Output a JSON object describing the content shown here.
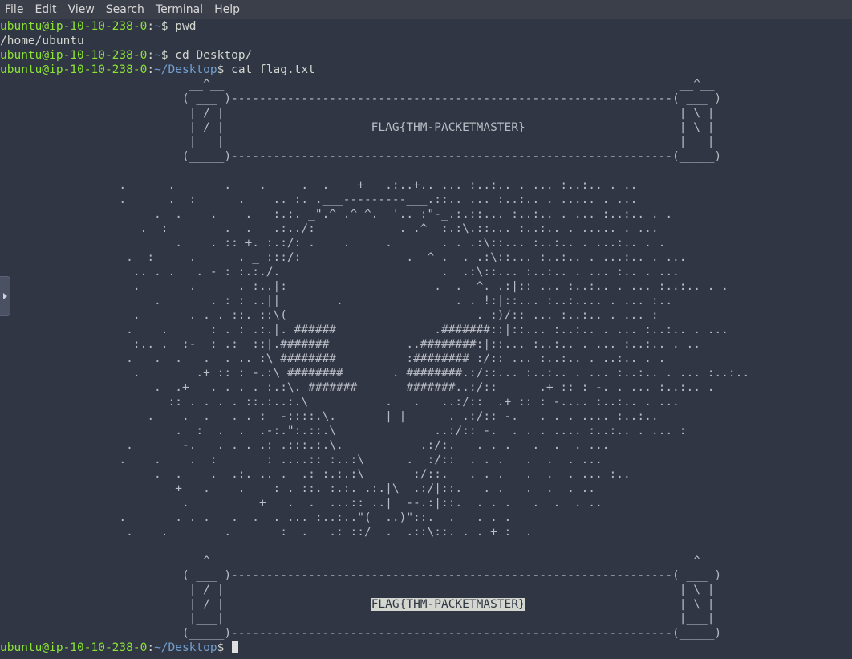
{
  "menu": {
    "items": [
      "File",
      "Edit",
      "View",
      "Search",
      "Terminal",
      "Help"
    ]
  },
  "terminal": {
    "lines": [
      {
        "user": "ubuntu@ip-10-10-238-0",
        "sep": ":",
        "path": "~",
        "sigil": "$",
        "cmd": " pwd"
      },
      {
        "text": "/home/ubuntu"
      },
      {
        "user": "ubuntu@ip-10-10-238-0",
        "sep": ":",
        "path": "~",
        "sigil": "$",
        "cmd": " cd Desktop/"
      },
      {
        "user": "ubuntu@ip-10-10-238-0",
        "sep": ":",
        "path": "~/Desktop",
        "sigil": "$",
        "cmd": " cat flag.txt"
      },
      {
        "art": "                           __^__                                                                 __^__"
      },
      {
        "art": "                          ( ___ )---------------------------------------------------------------( ___ )"
      },
      {
        "art": "                           | / |                                                                 | \\ |"
      },
      {
        "art": "                           | / |                     FLAG{THM-PACKETMASTER}                      | \\ |"
      },
      {
        "art": "                           |___|                                                                 |___|"
      },
      {
        "art": "                          (_____)---------------------------------------------------------------(_____)"
      },
      {
        "art": ""
      },
      {
        "art": "                 .      .       .    .     .  .    +   .:..+.. ... :..:.. . ... :..:.. . .."
      },
      {
        "art": "                 .      .  :      .    .. :. .___---------___.::.. ... :..:.. . ..... . ..."
      },
      {
        "art": "                      .  .    .    .   :.:. _\".^ .^ ^.  '.. :\"-_.:.::... :..:.. . ... :..:.. . ."
      },
      {
        "art": "                    .  :        .  .   .:../:            . .^  :.:\\.::... :..:.. . ..... . ..."
      },
      {
        "art": "                         .    . :: +. :.:/: .    .     .       . . .:\\::... :..:.. . ...:.. . ."
      },
      {
        "art": "                  .  :     .      . _ :::/:               .  ^ .  . .:\\::... :..:.. . ...:.. . ..."
      },
      {
        "art": "                   .. . .   . - : :.:./.                       .  .:\\::... :..:.. . ... :.. . ..."
      },
      {
        "art": "                   .       .      . :..|:                     .  .  ^. .:|:: ... :..:.. . ... :..:.. . ."
      },
      {
        "art": "                      .       . : : ..||        .                . . !:|::... :..:.... . ... :.."
      },
      {
        "art": "                   .       . . . ::. ::\\(                           . :)/:: ... :..:.. . ... :"
      },
      {
        "art": "                  .    .      : . : .:.|. ######              .#######::|::... :..:.. . ... :..:.. . ..."
      },
      {
        "art": "                   :.. .  :-  : .:  ::|.#######           ..########:|::... :..:.. . ... :..:.. . .."
      },
      {
        "art": "                  .   .  .   .  . .. :\\ ########          :######## :/:: ... :..:.. . ..:.. . ."
      },
      {
        "art": "                   .        .+ :: : -.:\\ ########       . ########.:/::... :..:.. . ... :..:.. . ... :..:.."
      },
      {
        "art": "                      .  .+   . . . . :.:\\. #######       #######..:/::      .+ :: : -. . ... :..:.. ."
      },
      {
        "art": "                        :: . . . . ::.:..:.\\           .   .   ..:/::  .+ :: : -.... :..:.. . ..."
      },
      {
        "art": "                     .    .  .   . . :  -::::.\\.       | |      . .:/:: -.   . . . .... :..:.."
      },
      {
        "art": "                         .  :  .  .  .-:.\":.::.\\              ..:/:: -.  . . . .... :..:.. . ... :"
      },
      {
        "art": "                  .       -.   . . . .: .:::.:.\\.           .:/:.   . . .   .  .  . ..."
      },
      {
        "art": "                 .    .    .  :       : ....::_:..:\\   ___.  :/::  . . .   .  .  . ..."
      },
      {
        "art": "                      .  .    .  .:. .. .  .: :.:.:\\       :/::.   . . .   .  .  . ... :.."
      },
      {
        "art": "                         +   .    .    : . ::. :.:. .:.|\\  .:/|::.   . .   .  .  . .."
      },
      {
        "art": "                          .          +   .  .  ...:: ..|  --.:|::.  . . .   .  .  . .."
      },
      {
        "art": "                 .       . . .   .  .  . ... :..:..\"(  ..)\"::.  .   . . ."
      },
      {
        "art": "                  .    .        .       :  .   .: ::/  .  .::\\::. . . + :  ."
      },
      {
        "art": ""
      },
      {
        "art": "                           __^__                                                                 __^__"
      },
      {
        "art": "                          ( ___ )---------------------------------------------------------------( ___ )"
      },
      {
        "art": "                           | / |                                                                 | \\ |"
      },
      {
        "art_pre": "                           | / |                     ",
        "art_hl": "FLAG{THM-PACKETMASTER}",
        "art_post": "                      | \\ |"
      },
      {
        "art": "                           |___|                                                                 |___|"
      },
      {
        "art": "                          (_____)---------------------------------------------------------------(_____)"
      },
      {
        "user": "ubuntu@ip-10-10-238-0",
        "sep": ":",
        "path": "~/Desktop",
        "sigil": "$",
        "cmd": " ",
        "cursor": true
      }
    ]
  },
  "colors": {
    "prompt_user": "#8ae234",
    "prompt_path": "#729fcf",
    "background": "#313644"
  }
}
